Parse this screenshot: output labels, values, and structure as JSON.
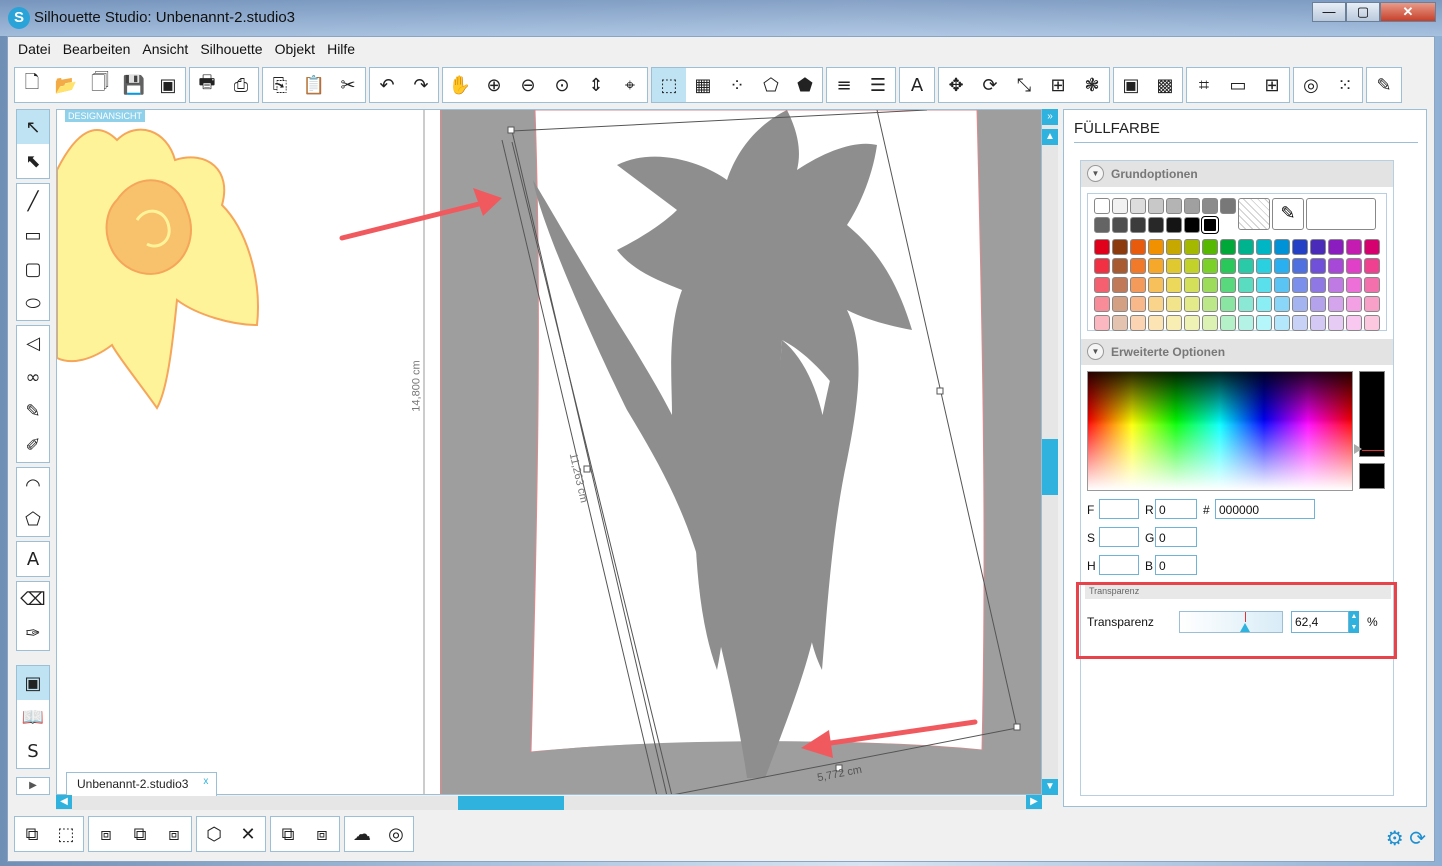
{
  "window": {
    "title": "Silhouette Studio: Unbenannt-2.studio3",
    "app_icon": "S"
  },
  "window_buttons": {
    "minimize": "—",
    "maximize": "▢",
    "close": "✕"
  },
  "menu": [
    "Datei",
    "Bearbeiten",
    "Ansicht",
    "Silhouette",
    "Objekt",
    "Hilfe"
  ],
  "toolbar_groups": [
    [
      "new-file-icon",
      "open-folder-icon",
      "open-recent-icon",
      "save-icon",
      "save-to-sd-icon"
    ],
    [
      "print-icon",
      "send-to-cutter-icon"
    ],
    [
      "copy-icon",
      "paste-icon",
      "cut-icon"
    ],
    [
      "undo-icon",
      "redo-icon"
    ],
    [
      "pan-hand-icon",
      "zoom-in-icon",
      "zoom-out-icon",
      "zoom-select-icon",
      "fit-to-page-icon",
      "zoom-all-icon"
    ],
    [
      "fill-color-icon",
      "gradient-fill-icon",
      "pattern-fill-icon",
      "line-color-icon",
      "line-style-icon"
    ],
    [
      "line-width-icon",
      "line-type-icon"
    ],
    [
      "text-style-icon"
    ],
    [
      "align-icon",
      "rotate-icon",
      "scale-icon",
      "move-icon",
      "replicate-icon"
    ],
    [
      "modify-icon",
      "offset-icon"
    ],
    [
      "page-setup-icon",
      "registration-icon",
      "grid-icon"
    ],
    [
      "trace-icon",
      "sketch-icon"
    ],
    [
      "eraser-panel-icon"
    ]
  ],
  "toolbar_glyphs": [
    "🗋",
    "📂",
    "🗍",
    "💾",
    "▣",
    "🖶",
    "⎙",
    "⎘",
    "📋",
    "✂",
    "↶",
    "↷",
    "✋",
    "⊕",
    "⊖",
    "⊙",
    "⇕",
    "⌖",
    "⬚",
    "▦",
    "⁘",
    "⬠",
    "⬟",
    "≡",
    "☰",
    "A",
    "✥",
    "⟳",
    "⤡",
    "⊞",
    "❃",
    "▣",
    "▩",
    "⌗",
    "▭",
    "⊞",
    "◎",
    "⁙",
    "✎"
  ],
  "left_tools": [
    {
      "name": "select-tool-icon",
      "glyph": "↖",
      "active": true
    },
    {
      "name": "point-edit-icon",
      "glyph": "⬉"
    },
    {
      "name": "line-tool-icon",
      "glyph": "╱"
    },
    {
      "name": "rectangle-tool-icon",
      "glyph": "▭"
    },
    {
      "name": "rounded-rectangle-tool-icon",
      "glyph": "▢"
    },
    {
      "name": "ellipse-tool-icon",
      "glyph": "⬭"
    },
    {
      "name": "polygon-tool-icon",
      "glyph": "◁"
    },
    {
      "name": "curve-tool-icon",
      "glyph": "∞"
    },
    {
      "name": "freehand-tool-icon",
      "glyph": "✎"
    },
    {
      "name": "smooth-freehand-tool-icon",
      "glyph": "✐"
    },
    {
      "name": "arc-tool-icon",
      "glyph": "◠"
    },
    {
      "name": "regular-polygon-tool-icon",
      "glyph": "⬠"
    },
    {
      "name": "text-tool-icon",
      "glyph": "A"
    },
    {
      "name": "eraser-tool-icon",
      "glyph": "⌫"
    },
    {
      "name": "knife-tool-icon",
      "glyph": "✑"
    },
    {
      "name": "design-view-icon",
      "glyph": "▣",
      "active": true
    },
    {
      "name": "library-icon",
      "glyph": "📖"
    },
    {
      "name": "store-icon",
      "glyph": "S"
    }
  ],
  "canvas": {
    "design_label": "DESIGNANSICHT",
    "dim_height": "14,800 cm",
    "dim_diagonal": "11,263 cm",
    "dim_width": "5,772 cm"
  },
  "doc_tab": {
    "label": "Unbenannt-2.studio3",
    "close": "x"
  },
  "tab_play": "▶",
  "bottom_tools": [
    "group-icon",
    "ungroup-icon",
    "compound-path-icon",
    "release-compound-icon",
    "bring-to-front-icon",
    "3d-box-icon",
    "delete-cross-icon",
    "send-back-icon",
    "send-backward-icon",
    "shape-icon",
    "spiral-icon"
  ],
  "bottom_glyphs": [
    "⧉",
    "⬚",
    "⧈",
    "⧉",
    "⧈",
    "⬡",
    "✕",
    "⧉",
    "⧈",
    "☁",
    "◎"
  ],
  "panel": {
    "title": "FÜLLFARBE",
    "basic_options": "Grundoptionen",
    "advanced_options": "Erweiterte Optionen",
    "fields": {
      "f_label": "F",
      "f_value": "",
      "s_label": "S",
      "s_value": "",
      "h_label": "H",
      "h_value": "",
      "r_label": "R",
      "r_value": "0",
      "g_label": "G",
      "g_value": "0",
      "b_label": "B",
      "b_value": "0",
      "hash_label": "#",
      "hex_value": "000000"
    },
    "transparency_header": "Transparenz",
    "transparency_label": "Transparenz",
    "transparency_value": "62,4",
    "transparency_percent": 62.4,
    "transparency_unit": "%"
  },
  "swatch_rows": [
    [
      "#ffffff",
      "#f2f2f2",
      "#dddddd",
      "#c8c8c8",
      "#b4b4b4",
      "#a0a0a0",
      "#8c8c8c",
      "#787878"
    ],
    [
      "#646464",
      "#505050",
      "#3c3c3c",
      "#282828",
      "#141414",
      "#000000",
      "#000000"
    ],
    [
      "#e0001b",
      "#8a3a0d",
      "#e85a0c",
      "#f29100",
      "#c6a800",
      "#a5b800",
      "#56b800",
      "#00a83a",
      "#00b38f",
      "#00b6c4",
      "#0092d6",
      "#2440c4",
      "#4a2ab8",
      "#8a1cc0",
      "#c41cb0",
      "#d6006e"
    ],
    [
      "#f23044",
      "#a85a30",
      "#f07a2a",
      "#f6a82a",
      "#e0c830",
      "#c2d22a",
      "#7cd02a",
      "#2ac85a",
      "#2acaa8",
      "#2ad0e0",
      "#2ab0f0",
      "#5070e0",
      "#7050d8",
      "#a848d8",
      "#e040c8",
      "#f04090"
    ],
    [
      "#f46070",
      "#c07a58",
      "#f49a5a",
      "#f8c05a",
      "#ecd85a",
      "#d4e05a",
      "#9cdc5a",
      "#5ad87e",
      "#5adcc0",
      "#5ae0ec",
      "#5ac4f4",
      "#7a90ea",
      "#9078e4",
      "#c07ae4",
      "#ec70d8",
      "#f470ac"
    ],
    [
      "#f88c98",
      "#d4a084",
      "#f8b88a",
      "#fad48a",
      "#f2e48a",
      "#e2ea8a",
      "#bce88a",
      "#8ae4a2",
      "#8ae8d4",
      "#8aeef4",
      "#8ad6f8",
      "#a4b4f0",
      "#b4a2ec",
      "#d4a4ec",
      "#f4a0e4",
      "#f8a0c8"
    ],
    [
      "#fbb8c0",
      "#e4c4b0",
      "#fbd4b4",
      "#fce4b4",
      "#f8eeb4",
      "#eef2b4",
      "#dcf2b4",
      "#b4f0c8",
      "#b4f2e6",
      "#b4f6fa",
      "#b4e6fc",
      "#c8d2f6",
      "#d4c8f4",
      "#e6ccf4",
      "#f8c8f0",
      "#fbc8e0"
    ]
  ],
  "colors": {
    "accent": "#2fb3de",
    "highlight": "#e8434a",
    "flower_fill": "#fff39a",
    "flower_stroke": "#f5a65a",
    "shape_gray": "#8c8c8c"
  }
}
